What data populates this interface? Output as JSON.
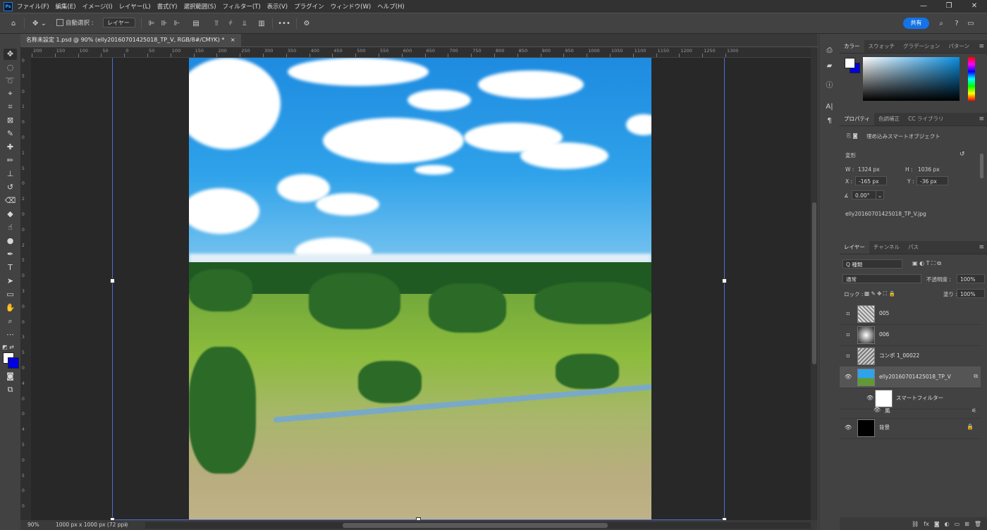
{
  "app": {
    "logo": "Ps"
  },
  "menu": [
    "ファイル(F)",
    "編集(E)",
    "イメージ(I)",
    "レイヤー(L)",
    "書式(Y)",
    "選択範囲(S)",
    "フィルター(T)",
    "表示(V)",
    "プラグイン",
    "ウィンドウ(W)",
    "ヘルプ(H)"
  ],
  "window_controls": {
    "minimize": "—",
    "restore": "❐",
    "close": "✕"
  },
  "options": {
    "home_icon": "home-icon",
    "move_icon": "move-icon",
    "auto_select_label": "自動選択 :",
    "auto_select_target": "レイヤー",
    "more": "•••",
    "share_label": "共有"
  },
  "document_tab": {
    "title": "名称未設定 1.psd @ 90% (elly20160701425018_TP_V, RGB/8#/CMYK) *",
    "close": "×"
  },
  "ruler": {
    "h_labels": [
      "200",
      "150",
      "100",
      "50",
      "0",
      "50",
      "100",
      "150",
      "200",
      "250",
      "300",
      "350",
      "400",
      "450",
      "500",
      "550",
      "600",
      "650",
      "700",
      "750",
      "800",
      "850",
      "900",
      "950",
      "1000",
      "1050",
      "1100",
      "1150",
      "1200",
      "1250",
      "1300"
    ],
    "v_labels": [
      "0",
      "5",
      "0",
      "1",
      "0",
      "0",
      "1",
      "5",
      "0",
      "2",
      "0",
      "0",
      "2",
      "5",
      "0",
      "3",
      "0",
      "0",
      "3",
      "5",
      "0",
      "4",
      "0",
      "0",
      "4",
      "5",
      "0",
      "5",
      "0",
      "0"
    ]
  },
  "status": {
    "zoom": "90%",
    "doc_size": "1000 px x 1000 px (72 ppi)"
  },
  "color_panel": {
    "tabs": [
      "カラー",
      "スウォッチ",
      "グラデーション",
      "パターン"
    ],
    "fg": "#ffffff",
    "bg": "#0000e0"
  },
  "properties_panel": {
    "tabs": [
      "プロパティ",
      "色調補正",
      "CC ライブラリ"
    ],
    "object_type": "埋め込みスマートオブジェクト",
    "section": "変形",
    "w_label": "W :",
    "w_value": "1324 px",
    "h_label": "H :",
    "h_value": "1036 px",
    "x_label": "X :",
    "x_value": "-165 px",
    "y_label": "Y :",
    "y_value": "-36 px",
    "angle_value": "0.00°",
    "filename": "elly20160701425018_TP_V.jpg"
  },
  "layers_panel": {
    "tabs": [
      "レイヤー",
      "チャンネル",
      "パス"
    ],
    "filter_label": "Q 種類",
    "blend_mode": "通常",
    "opacity_label": "不透明度 :",
    "opacity_value": "100%",
    "lock_label": "ロック :",
    "fill_label": "塗り :",
    "fill_value": "100%",
    "layers": [
      {
        "name": "005",
        "visible": false
      },
      {
        "name": "006",
        "visible": false
      },
      {
        "name": "コンポ 1_00022",
        "visible": false
      },
      {
        "name": "elly20160701425018_TP_V",
        "visible": true,
        "selected": true
      },
      {
        "name": "スマートフィルター",
        "visible": true,
        "sub": true
      },
      {
        "name": "風",
        "visible": true,
        "sub": true
      },
      {
        "name": "背景",
        "visible": true,
        "locked": true
      }
    ],
    "bottom_icons": [
      "link-icon",
      "fx-icon",
      "mask-icon",
      "adjustment-icon",
      "group-icon",
      "new-layer-icon",
      "trash-icon"
    ]
  },
  "colors": {
    "accent": "#1473e6",
    "transform_box": "#4f6bd8"
  }
}
